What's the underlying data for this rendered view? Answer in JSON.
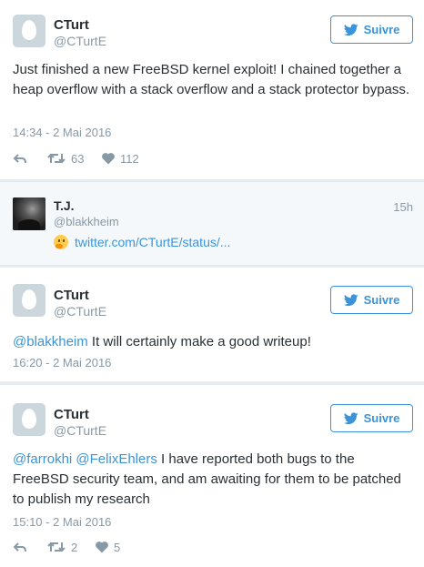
{
  "tweet1": {
    "name": "CTurt",
    "handle": "@CTurtE",
    "follow_label": "Suivre",
    "text": "Just finished a new FreeBSD kernel exploit! I chained together a heap overflow with a stack overflow and a stack protector bypass.",
    "time": "14:34 - 2 Mai 2016",
    "retweets": "63",
    "likes": "112"
  },
  "reply": {
    "name": "T.J.",
    "handle": "@blakkheim",
    "age": "15h",
    "link": "twitter.com/CTurtE/status/..."
  },
  "tweet2": {
    "name": "CTurt",
    "handle": "@CTurtE",
    "follow_label": "Suivre",
    "mention": "@blakkheim",
    "text": " It will certainly make a good writeup!",
    "time": "16:20 - 2 Mai 2016"
  },
  "tweet3": {
    "name": "CTurt",
    "handle": "@CTurtE",
    "follow_label": "Suivre",
    "mention1": "@farrokhi",
    "mention2": "@FelixEhlers",
    "text": " I have reported both bugs to the FreeBSD security team, and am awaiting for them to be patched to publish my research",
    "time": "15:10 - 2 Mai 2016",
    "retweets": "2",
    "likes": "5"
  },
  "icons": {
    "bird": "twitter-bird-icon",
    "reply": "reply-icon",
    "retweet": "retweet-icon",
    "like": "heart-icon",
    "emoji": "thinking-face-icon"
  },
  "colors": {
    "accent": "#3b94d9",
    "muted": "#8899a6",
    "text": "#292f33",
    "reply_bg": "#f5f8fa",
    "separator": "#e6ecf0"
  }
}
